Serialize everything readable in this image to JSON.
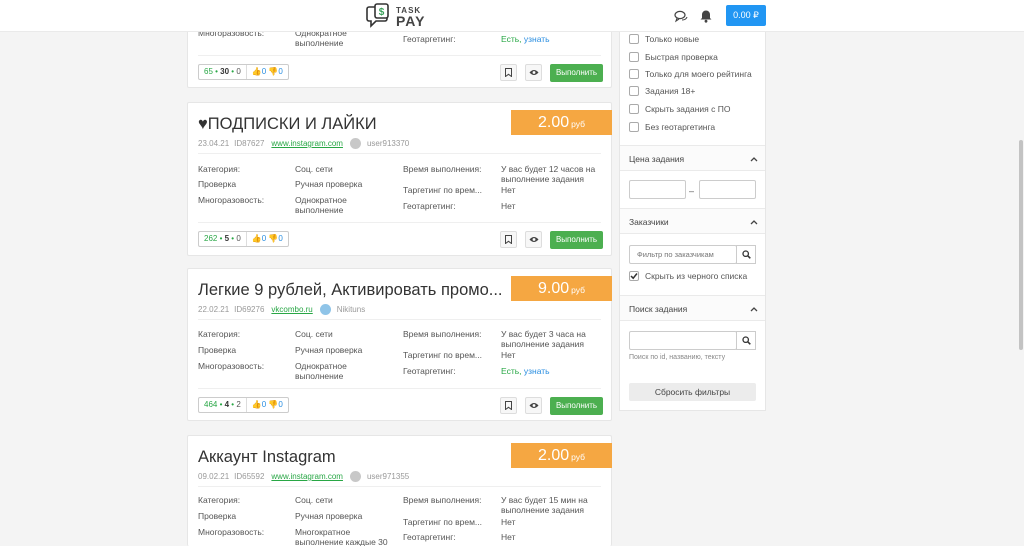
{
  "header": {
    "logo_line1": "TASK",
    "logo_line2": "PAY",
    "logo_icon": "dollar-chat-icon",
    "messages_icon": "chat-bubbles-icon",
    "notifications_icon": "bell-icon",
    "balance": "0.00 ₽"
  },
  "top_card": {
    "row_label": "Многоразовость:",
    "row_value": "Однократное выполнение",
    "geo_label": "Геотаргетинг:",
    "geo_value_1": "Есть,",
    "geo_value_2": "узнать",
    "stats_left": "65",
    "stats_mid": "30",
    "stats_right": "0",
    "likes": "0",
    "dislikes": "0",
    "execute_label": "Выполнить"
  },
  "tasks": [
    {
      "title": "♥ПОДПИСКИ И ЛАЙКИ",
      "price": "2.00",
      "currency": "руб",
      "date": "23.04.21",
      "id": "ID87627",
      "link": "www.instagram.com",
      "user": "user913370",
      "category_label": "Категория:",
      "category_value": "Соц. сети",
      "check_label": "Проверка",
      "check_value": "Ручная проверка",
      "repeat_label": "Многоразовость:",
      "repeat_value": "Однократное выполнение",
      "time_label": "Время выполнения:",
      "time_value": "У вас будет 12 часов на выполнение задания",
      "tt_label": "Таргетинг по врем...",
      "tt_value": "Нет",
      "geo_label": "Геотаргетинг:",
      "geo_value": "Нет",
      "stats_left": "262",
      "stats_mid": "5",
      "stats_right": "0",
      "likes": "0",
      "dislikes": "0",
      "execute_label": "Выполнить"
    },
    {
      "title": "Легкие 9 рублей, Активировать промо...",
      "price": "9.00",
      "currency": "руб",
      "date": "22.02.21",
      "id": "ID69276",
      "link": "vkcombo.ru",
      "user": "Nikituns",
      "category_label": "Категория:",
      "category_value": "Соц. сети",
      "check_label": "Проверка",
      "check_value": "Ручная проверка",
      "repeat_label": "Многоразовость:",
      "repeat_value": "Однократное выполнение",
      "time_label": "Время выполнения:",
      "time_value": "У вас будет 3 часа на выполнение задания",
      "tt_label": "Таргетинг по врем...",
      "tt_value": "Нет",
      "geo_label": "Геотаргетинг:",
      "geo_value_1": "Есть,",
      "geo_value_2": "узнать",
      "stats_left": "464",
      "stats_mid": "4",
      "stats_right": "2",
      "likes": "0",
      "dislikes": "0",
      "execute_label": "Выполнить"
    },
    {
      "title": "Аккаунт Instagram",
      "price": "2.00",
      "currency": "руб",
      "date": "09.02.21",
      "id": "ID65592",
      "link": "www.instagram.com",
      "user": "user971355",
      "category_label": "Категория:",
      "category_value": "Соц. сети",
      "check_label": "Проверка",
      "check_value": "Ручная проверка",
      "repeat_label": "Многоразовость:",
      "repeat_value": "Многократное выполнение каждые 30",
      "time_label": "Время выполнения:",
      "time_value": "У вас будет 15 мин на выполнение задания",
      "tt_label": "Таргетинг по врем...",
      "tt_value": "Нет",
      "geo_label": "Геотаргетинг:",
      "geo_value": "Нет"
    }
  ],
  "filters": {
    "checkboxes": [
      {
        "label": "Только новые",
        "checked": false
      },
      {
        "label": "Быстрая проверка",
        "checked": false
      },
      {
        "label": "Только для моего рейтинга",
        "checked": false
      },
      {
        "label": "Задания 18+",
        "checked": false
      },
      {
        "label": "Скрыть задания с ПО",
        "checked": false
      },
      {
        "label": "Без геотаргетинга",
        "checked": false
      }
    ],
    "price_section": "Цена задания",
    "price_from": "",
    "price_to": "",
    "price_dash": "–",
    "customers_section": "Заказчики",
    "customers_placeholder": "Фильтр по заказчикам",
    "hide_blacklist": "Скрыть из черного списка",
    "search_section": "Поиск задания",
    "search_value": "",
    "search_hint": "Поиск по id, названию, тексту",
    "reset_label": "Сбросить фильтры"
  },
  "colors": {
    "price_bg": "#f5a742",
    "execute_bg": "#4caf50",
    "balance_bg": "#2196f3",
    "link_green": "#28a745",
    "link_blue": "#2a8ee0"
  }
}
